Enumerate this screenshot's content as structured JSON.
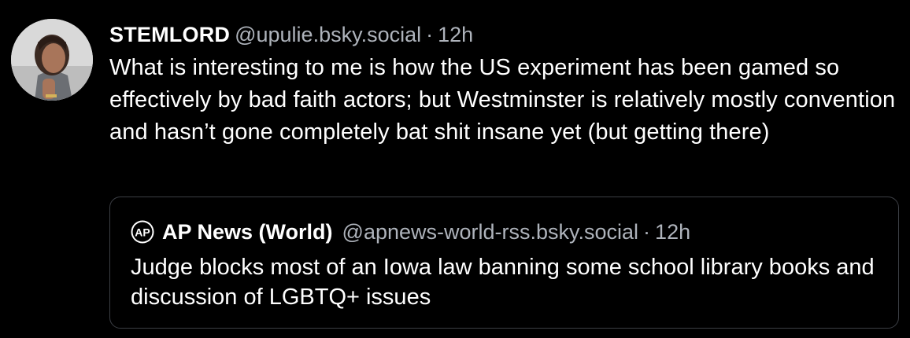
{
  "post": {
    "author": {
      "display_name": "STEMLORD",
      "handle": "@upulie.bsky.social",
      "avatar_icon": "user-photo-avatar"
    },
    "separator": "·",
    "time": "12h",
    "text": "What is interesting to me is how the US experiment has been gamed so effectively by bad faith actors; but Westminster is relatively mostly convention and hasn’t gone completely bat shit insane yet (but getting there)"
  },
  "quote": {
    "author": {
      "logo_icon": "ap-logo-icon",
      "logo_text": "AP",
      "display_name": "AP News (World)",
      "handle": "@apnews-world-rss.bsky.social"
    },
    "separator": "·",
    "time": "12h",
    "text": "Judge blocks most of an Iowa law banning some school library books and discussion of LGBTQ+ issues"
  },
  "colors": {
    "background": "#000000",
    "text": "#ffffff",
    "muted": "#aeb3bb",
    "border": "#3c3f45"
  }
}
